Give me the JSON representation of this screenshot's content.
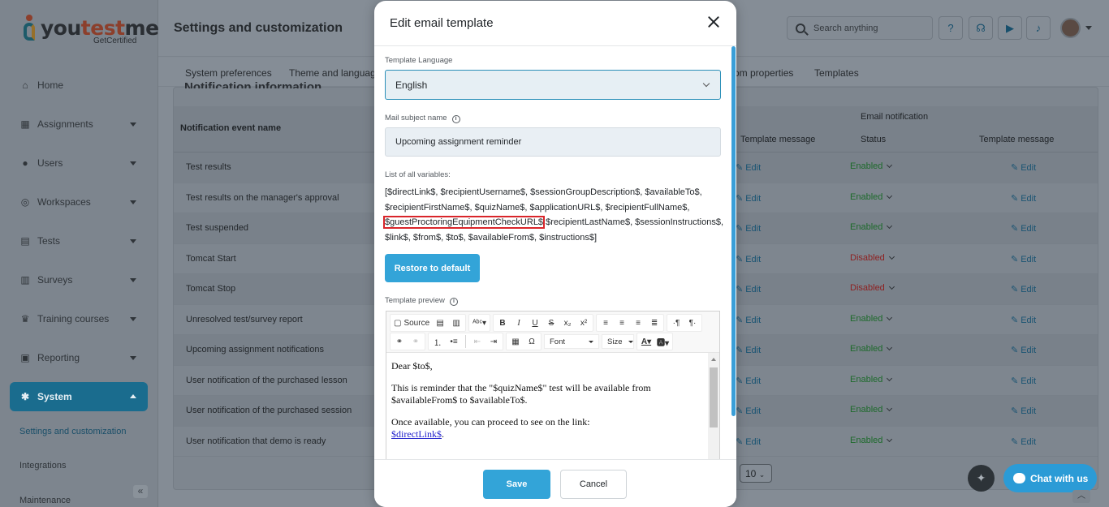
{
  "brand": {
    "name_prefix": "you",
    "name_highlight": "test",
    "name_suffix": "me",
    "tagline": "GetCertified"
  },
  "sidebar": {
    "items": [
      {
        "label": "Home",
        "icon": "home-icon"
      },
      {
        "label": "Assignments",
        "icon": "assignments-icon"
      },
      {
        "label": "Users",
        "icon": "users-icon"
      },
      {
        "label": "Workspaces",
        "icon": "globe-icon"
      },
      {
        "label": "Tests",
        "icon": "tests-icon"
      },
      {
        "label": "Surveys",
        "icon": "surveys-icon"
      },
      {
        "label": "Training courses",
        "icon": "trophy-icon"
      },
      {
        "label": "Reporting",
        "icon": "reporting-icon"
      },
      {
        "label": "System",
        "icon": "gear-icon"
      }
    ],
    "sub_items": [
      "Settings and customization",
      "Integrations",
      "Maintenance"
    ],
    "collapse_glyph": "«"
  },
  "header": {
    "title": "Settings and customization",
    "search_placeholder": "Search anything"
  },
  "tabs": [
    "System preferences",
    "Theme and language",
    "om properties",
    "Templates"
  ],
  "table": {
    "heading": "Notification information",
    "col_event": "Notification event name",
    "group_email": "Email notification",
    "col_template": "Template message",
    "col_status": "Status",
    "edit_label": "Edit",
    "rows": [
      {
        "name": "Test results",
        "status": "Enabled",
        "state": "en"
      },
      {
        "name": "Test results on the manager's approval",
        "status": "Enabled",
        "state": "en"
      },
      {
        "name": "Test suspended",
        "status": "Enabled",
        "state": "en"
      },
      {
        "name": "Tomcat Start",
        "status": "Disabled",
        "state": "dis"
      },
      {
        "name": "Tomcat Stop",
        "status": "Disabled",
        "state": "dis"
      },
      {
        "name": "Unresolved test/survey report",
        "status": "Enabled",
        "state": "en"
      },
      {
        "name": "Upcoming assignment notifications",
        "status": "Enabled",
        "state": "en"
      },
      {
        "name": "User notification of the purchased lesson",
        "status": "Enabled",
        "state": "en"
      },
      {
        "name": "User notification of the purchased session",
        "status": "Enabled",
        "state": "en"
      },
      {
        "name": "User notification that demo is ready",
        "status": "Enabled",
        "state": "en"
      }
    ],
    "page_size": "10"
  },
  "chat": {
    "label": "Chat with us"
  },
  "modal": {
    "title": "Edit email template",
    "template_language_label": "Template Language",
    "template_language_value": "English",
    "mail_subject_label": "Mail subject name",
    "mail_subject_value": "Upcoming assignment reminder",
    "variables_label": "List of all variables:",
    "variables_before": "[$directLink$, $recipientUsername$, $sessionGroupDescription$, $availableTo$, $recipientFirstName$, $quizName$, $applicationURL$, $recipientFullName$, ",
    "variables_highlight": "$guestProctoringEquipmentCheckURL$",
    "variables_after": " $recipientLastName$, $sessionInstructions$, $link$, $from$, $to$, $availableFrom$, $instructions$]",
    "restore_label": "Restore to default",
    "preview_label": "Template preview",
    "toolbar": {
      "source": "Source",
      "font": "Font",
      "size": "Size"
    },
    "preview": {
      "p1": "Dear $to$,",
      "p2": "This is reminder that the \"$quizName$\" test will be available from $availableFrom$ to $availableTo$.",
      "p3": "Once available, you can proceed to see on the link:",
      "link": "$directLink$",
      "link_suffix": "."
    },
    "save_label": "Save",
    "cancel_label": "Cancel"
  },
  "colors": {
    "accent": "#33a4d8",
    "highlight_border": "#d9252a",
    "enabled": "#2e9c45",
    "disabled": "#d63a3a"
  }
}
